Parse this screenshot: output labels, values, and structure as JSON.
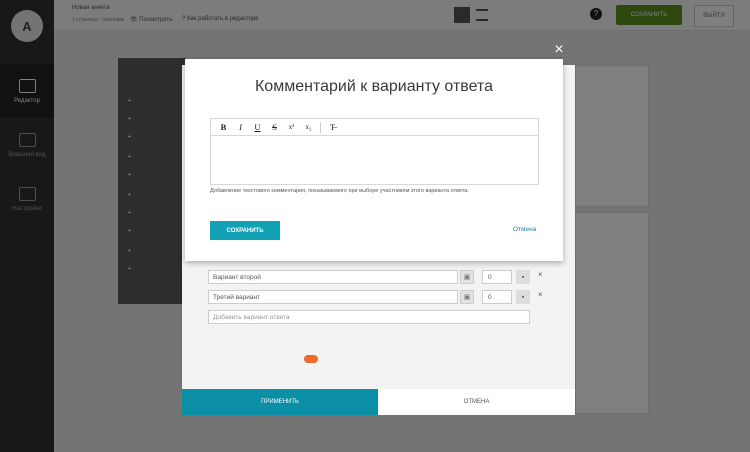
{
  "app": {
    "topbar": {
      "title": "Новая анкета",
      "subtitle": "1 страница · Черновик",
      "preview": "Посмотреть",
      "help": "Как работать в редакторе",
      "save_label": "СОХРАНИТЬ",
      "exit_label": "ВЫЙТИ"
    },
    "sidebar": {
      "logo_text": "A",
      "items": [
        {
          "label": "Редактор"
        },
        {
          "label": "Внешний вид"
        },
        {
          "label": "Настройки"
        }
      ]
    }
  },
  "behind_dialog": {
    "options": [
      {
        "value": "Вариант второй",
        "count": "0"
      },
      {
        "value": "Третий вариант",
        "count": "0"
      }
    ],
    "add_placeholder": "Добавить вариант ответа",
    "apply_label": "ПРИМЕНИТЬ",
    "cancel_label": "ОТМЕНА"
  },
  "modal": {
    "title": "Комментарий к варианту ответа",
    "toolbar": [
      {
        "name": "bold-tool",
        "glyph": "B"
      },
      {
        "name": "italic-tool",
        "glyph": "I"
      },
      {
        "name": "underline-tool",
        "glyph": "U"
      },
      {
        "name": "strike-tool",
        "glyph": "S"
      },
      {
        "name": "superscript-tool",
        "glyph": "x²"
      },
      {
        "name": "subscript-tool",
        "glyph": "x₂"
      },
      {
        "name": "clear-format-tool",
        "glyph": "T̶"
      }
    ],
    "help_text": "Добавление текстового комментария, показываемого при выборе участником этого варианта ответа.",
    "save_label": "СОХРАНИТЬ",
    "cancel_label": "Отмена"
  },
  "colors": {
    "accent": "#12a0b5",
    "save_green": "#5a8f1f",
    "link": "#1b7fb0"
  }
}
